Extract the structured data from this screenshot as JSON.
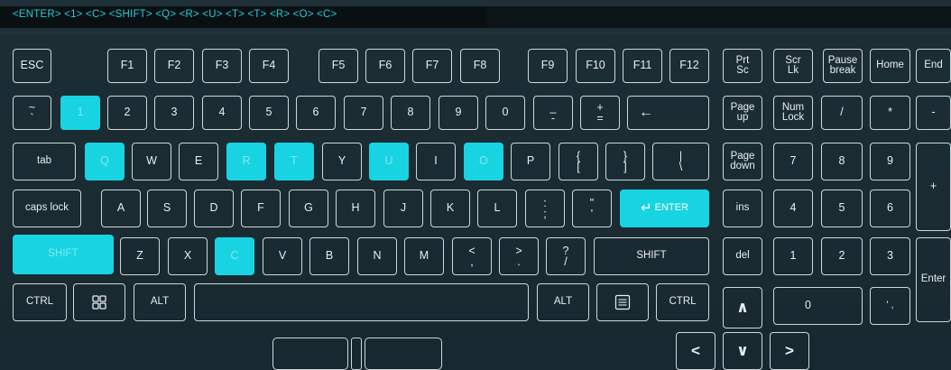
{
  "sequence_bar": {
    "text": "<ENTER> <1> <C> <SHIFT> <Q> <R> <U> <T> <T> <R> <O> <C>"
  },
  "keys": {
    "esc": "ESC",
    "f1": "F1",
    "f2": "F2",
    "f3": "F3",
    "f4": "F4",
    "f5": "F5",
    "f6": "F6",
    "f7": "F7",
    "f8": "F8",
    "f9": "F9",
    "f10": "F10",
    "f11": "F11",
    "f12": "F12",
    "prtsc_top": "Prt",
    "prtsc_bot": "Sc",
    "scrlk_top": "Scr",
    "scrlk_bot": "Lk",
    "pause_top": "Pause",
    "pause_bot": "break",
    "home": "Home",
    "end": "End",
    "tilde_top": "~",
    "tilde_bot": "`",
    "n1": "1",
    "n2": "2",
    "n3": "3",
    "n4": "4",
    "n5": "5",
    "n6": "6",
    "n7": "7",
    "n8": "8",
    "n9": "9",
    "n0": "0",
    "minus_top": "_",
    "minus_bot": "-",
    "plus_top": "+",
    "plus_bot": "=",
    "backspace": "←",
    "pageup_top": "Page",
    "pageup_bot": "up",
    "numlock_top": "Num",
    "numlock_bot": "Lock",
    "np_div": "/",
    "np_mul": "*",
    "np_sub": "-",
    "tab": "tab",
    "q": "Q",
    "w": "W",
    "e": "E",
    "r": "R",
    "t": "T",
    "y": "Y",
    "u": "U",
    "i": "I",
    "o": "O",
    "p": "P",
    "lbrace_top": "{",
    "lbrace_bot": "[",
    "rbrace_top": "}",
    "rbrace_bot": "]",
    "pipe_top": "|",
    "pipe_bot": "\\",
    "pagedown_top": "Page",
    "pagedown_bot": "down",
    "np7": "7",
    "np8": "8",
    "np9": "9",
    "np_add": "+",
    "capslock": "caps lock",
    "a": "A",
    "s": "S",
    "d": "D",
    "f": "F",
    "g": "G",
    "h": "H",
    "j": "J",
    "k": "K",
    "l": "L",
    "colon_top": ":",
    "colon_bot": ";",
    "quote_top": "\"",
    "quote_bot": "'",
    "enter_arrow": "↵",
    "enter": "ENTER",
    "ins": "ins",
    "np4": "4",
    "np5": "5",
    "np6": "6",
    "lshift": "SHIFT",
    "z": "Z",
    "x": "X",
    "c": "C",
    "v": "V",
    "b": "B",
    "n": "N",
    "m": "M",
    "lt_top": "<",
    "lt_bot": ",",
    "gt_top": ">",
    "gt_bot": ".",
    "question_top": "?",
    "question_bot": "/",
    "rshift": "SHIFT",
    "del": "del",
    "np1": "1",
    "np2": "2",
    "np3": "3",
    "np_enter": "Enter",
    "lctrl": "CTRL",
    "lalt": "ALT",
    "ralt": "ALT",
    "rctrl": "CTRL",
    "up": "∧",
    "np0": "0",
    "np_dot": "' ,",
    "left": "<",
    "down": "∨",
    "right": ">"
  },
  "colors": {
    "accent": "#18d4e2",
    "background": "#1c2e35",
    "key_border": "#cfd8db",
    "sequence_text": "#19d3df"
  },
  "icons": {
    "windows": "windows-icon",
    "menu": "context-menu-icon"
  },
  "highlighted_keys": [
    "1",
    "Q",
    "R",
    "T",
    "U",
    "O",
    "ENTER",
    "SHIFT",
    "C"
  ]
}
